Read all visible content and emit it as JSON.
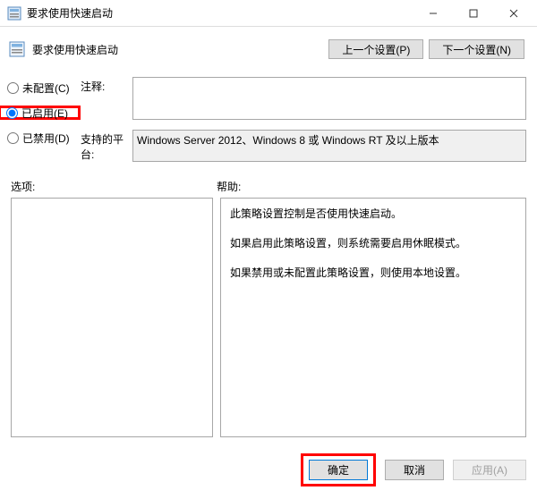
{
  "window": {
    "title": "要求使用快速启动",
    "min_tip": "Minimize",
    "max_tip": "Maximize",
    "close_tip": "Close"
  },
  "header": {
    "title": "要求使用快速启动",
    "prev": "上一个设置(P)",
    "next": "下一个设置(N)"
  },
  "radios": {
    "not_configured": "未配置(C)",
    "enabled": "已启用(E)",
    "disabled": "已禁用(D)",
    "selected": "enabled"
  },
  "fields": {
    "comment_label": "注释:",
    "comment_value": "",
    "supported_label": "支持的平台:",
    "supported_value": "Windows Server 2012、Windows 8 或 Windows RT 及以上版本"
  },
  "sections": {
    "options_label": "选项:",
    "help_label": "帮助:"
  },
  "help": {
    "p1": "此策略设置控制是否使用快速启动。",
    "p2": "如果启用此策略设置，则系统需要启用休眠模式。",
    "p3": "如果禁用或未配置此策略设置，则使用本地设置。"
  },
  "footer": {
    "ok": "确定",
    "cancel": "取消",
    "apply": "应用(A)"
  }
}
